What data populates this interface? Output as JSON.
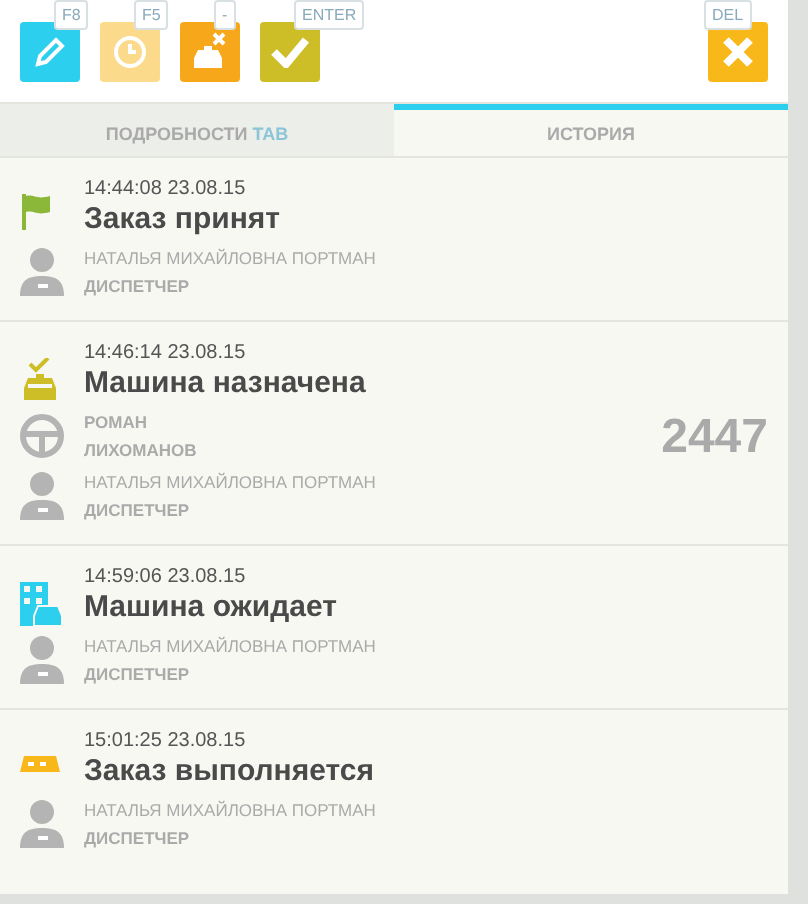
{
  "toolbar": {
    "buttons": [
      {
        "kind": "edit",
        "shortcut": "F8",
        "disabled": false
      },
      {
        "kind": "clock",
        "shortcut": "F5",
        "disabled": true
      },
      {
        "kind": "cancel-car",
        "shortcut": "-",
        "disabled": false
      },
      {
        "kind": "check",
        "shortcut": "ENTER",
        "disabled": false
      }
    ],
    "close": {
      "shortcut": "DEL"
    }
  },
  "tabs": [
    {
      "label": "ПОДРОБНОСТИ",
      "shortcut": "TAB",
      "selected": false
    },
    {
      "label": "ИСТОРИЯ",
      "selected": true
    }
  ],
  "events": [
    {
      "kind": "flag",
      "time": "14:44:08 23.08.15",
      "title": "Заказ принят",
      "operator": "НАТАЛЬЯ МИХАЙЛОВНА ПОРТМАН",
      "role": "ДИСПЕТЧЕР"
    },
    {
      "kind": "car-assigned",
      "time": "14:46:14 23.08.15",
      "title": "Машина назначена",
      "driver": [
        "РОМАН",
        "ЛИХОМАНОВ"
      ],
      "car_number": "2447",
      "operator": "НАТАЛЬЯ МИХАЙЛОВНА ПОРТМАН",
      "role": "ДИСПЕТЧЕР"
    },
    {
      "kind": "car-waiting",
      "time": "14:59:06 23.08.15",
      "title": "Машина ожидает",
      "operator": "НАТАЛЬЯ МИХАЙЛОВНА ПОРТМАН",
      "role": "ДИСПЕТЧЕР"
    },
    {
      "kind": "taxi",
      "time": "15:01:25 23.08.15",
      "title": "Заказ выполняется",
      "operator": "НАТАЛЬЯ МИХАЙЛОВНА ПОРТМАН",
      "role": "ДИСПЕТЧЕР"
    }
  ]
}
